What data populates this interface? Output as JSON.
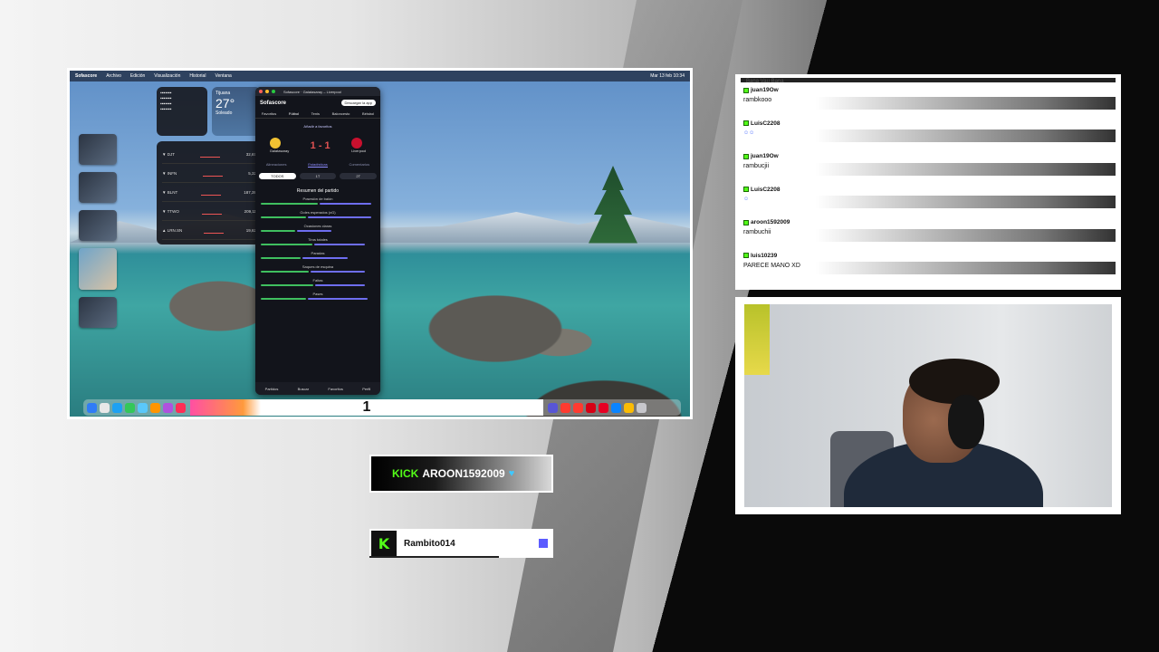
{
  "colors": {
    "kick_green": "#53fc18",
    "chat_bg": "#ffffff",
    "stream_dark": "#0a0a0a",
    "accent_purple": "#5b5bff"
  },
  "desktop": {
    "menubar": {
      "app": "Sofascore",
      "items": [
        "Archivo",
        "Edición",
        "Visualización",
        "Historial",
        "Ventana"
      ],
      "clock": "Mar 13 feb 10:34"
    },
    "weather": {
      "city": "Tijuana",
      "temp": "27°",
      "desc": "Soleado"
    },
    "stocks": [
      {
        "symbol": "▼ DJT",
        "price": "32,67"
      },
      {
        "symbol": "▼ INFN",
        "price": "5,32"
      },
      {
        "symbol": "▼ BLNT",
        "price": "187,39"
      },
      {
        "symbol": "▼ TTWO",
        "price": "209,11"
      },
      {
        "symbol": "▲ LRN.SN",
        "price": "19,62"
      }
    ],
    "sofascore": {
      "window_title": "Sofascore · Galatasaray – Liverpool",
      "brand": "Sofascore",
      "download": "Descargar la app",
      "nav": [
        "Favoritos",
        "Fútbol",
        "Tenis",
        "Baloncesto",
        "Béisbol"
      ],
      "score": "1 - 1",
      "home_team": "Galatasaray",
      "away_team": "Liverpool",
      "favorite": "Añadir a favoritos",
      "tabs": [
        "Alineaciones",
        "Estadísticas",
        "Comentarios"
      ],
      "periods": [
        "TODOS",
        "1T",
        "2T"
      ],
      "summary_title": "Resumen del partido",
      "stats": [
        "Posesión de balón",
        "Goles esperados (xG)",
        "Ocasiones claras",
        "Tiros totales",
        "Paradas",
        "Saques de esquina",
        "Faltas",
        "Pases"
      ],
      "footer": [
        "Partidos",
        "Buscar",
        "Favoritos",
        "Perfil"
      ]
    },
    "dock_counter": "1"
  },
  "chat": {
    "header": "Bana Vau Bana",
    "messages": [
      {
        "user": "juan19Ow",
        "text": "rambkooo",
        "emote": false
      },
      {
        "user": "LuisC2208",
        "text": "☺☺",
        "emote": true
      },
      {
        "user": "juan19Ow",
        "text": "rambucjii",
        "emote": false
      },
      {
        "user": "LuisC2208",
        "text": "☺",
        "emote": true
      },
      {
        "user": "aroon1592009",
        "text": "rambuchii",
        "emote": false
      },
      {
        "user": "luis10239",
        "text": "PARECE MANO XD",
        "emote": false
      }
    ]
  },
  "kick_banner": {
    "brand": "KICK",
    "username": "AROON1592009",
    "icon": "heart-icon"
  },
  "kick_tag": {
    "logo": "K",
    "username": "Rambito014"
  }
}
